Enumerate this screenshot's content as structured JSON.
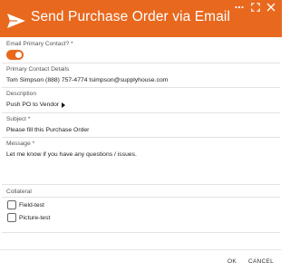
{
  "window": {
    "title": "Send Purchase Order via Email",
    "header_color": "#e8681e",
    "icons": [
      "send-icon",
      "more-options-icon",
      "expand-icon",
      "close-icon"
    ]
  },
  "form": {
    "email_primary_contact": {
      "label": "Email Primary Contact? *",
      "on": true
    },
    "primary_contact_details": {
      "label": "Primary Contact Details",
      "value": "Tom Simpson (888) 757-4774 tsimpson@supplyhouse.com"
    },
    "description": {
      "label": "Description",
      "value": "Push PO to Vendor"
    },
    "subject": {
      "label": "Subject *",
      "value": "Please fill this Purchase Order"
    },
    "message": {
      "label": "Message *",
      "value": "Let me know if you have any questions / issues."
    },
    "collateral": {
      "label": "Collateral",
      "items": [
        {
          "label": "Field-test",
          "checked": false
        },
        {
          "label": "Picture-test",
          "checked": false
        }
      ]
    }
  },
  "footer": {
    "ok_label": "OK",
    "cancel_label": "CANCEL"
  }
}
